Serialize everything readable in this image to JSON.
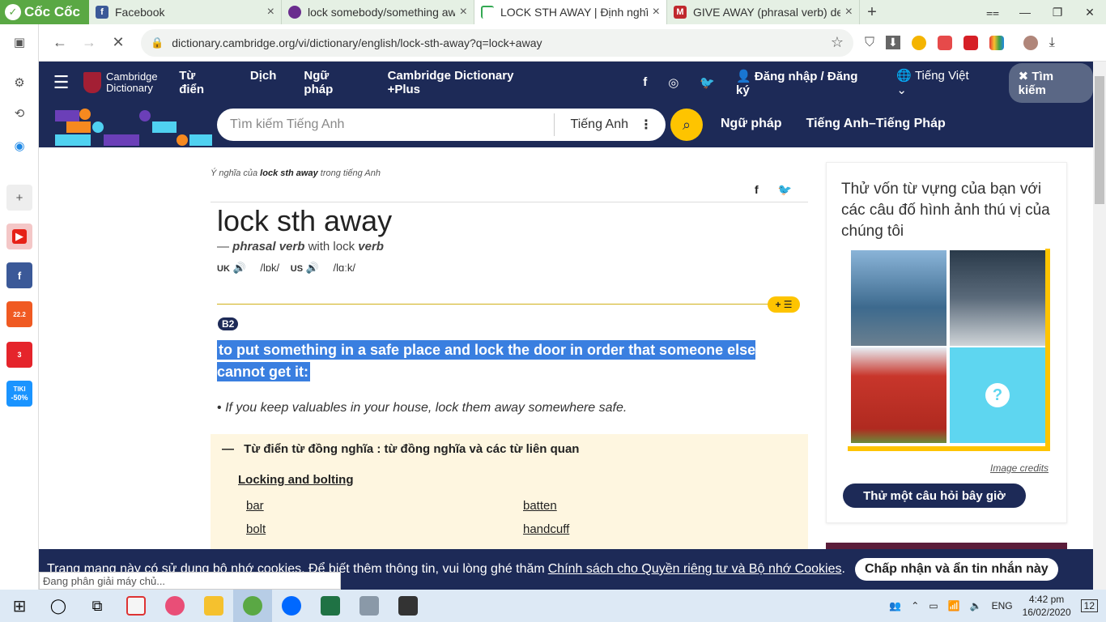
{
  "browser": {
    "brand": "Cốc Cốc",
    "tabs": [
      {
        "label": "Facebook",
        "active": false
      },
      {
        "label": "lock somebody/something aw",
        "active": false
      },
      {
        "label": "LOCK STH AWAY | Định nghĩa",
        "active": true
      },
      {
        "label": "GIVE AWAY (phrasal verb) def",
        "active": false
      }
    ],
    "url": "dictionary.cambridge.org/vi/dictionary/english/lock-sth-away?q=lock+away"
  },
  "header": {
    "logo_line1": "Cambridge",
    "logo_line2": "Dictionary",
    "nav": [
      "Từ điển",
      "Dịch",
      "Ngữ pháp",
      "Cambridge Dictionary +Plus"
    ],
    "login": "Đăng nhập / Đăng ký",
    "language": "Tiếng Việt",
    "search_button": "Tìm kiếm"
  },
  "search": {
    "placeholder": "Tìm kiếm Tiếng Anh",
    "dictionary": "Tiếng Anh",
    "links": [
      "Ngữ pháp",
      "Tiếng Anh–Tiếng Pháp"
    ]
  },
  "entry": {
    "breadcrumb_pre": "Ý nghĩa của",
    "breadcrumb_word": "lock sth away",
    "breadcrumb_post": "trong tiếng Anh",
    "headword": "lock sth away",
    "pos_dash": "—",
    "pos": "phrasal verb",
    "pos_with": "with lock",
    "pos_verb": "verb",
    "uk": "UK",
    "uk_ipa": "/lɒk/",
    "us": "US",
    "us_ipa": "/lɑːk/",
    "level": "B2",
    "definition": "to put something in a safe place and lock the door in order that someone else cannot get it:",
    "example": "If you keep valuables in your house, lock them away somewhere safe.",
    "thesaurus_header": "Từ điển từ đồng nghĩa : từ đồng nghĩa và các từ liên quan",
    "thesaurus_category": "Locking and bolting",
    "words": [
      "bar",
      "batten",
      "bolt",
      "handcuff"
    ]
  },
  "panel": {
    "title": "Thử vốn từ vựng của bạn với các câu đố hình ảnh thú vị của chúng tôi",
    "credits": "Image credits",
    "cta": "Thử một câu hỏi bây giờ"
  },
  "cookie": {
    "text": "Trang mạng này có sử dụng bộ nhớ cookies. Để biết thêm thông tin, vui lòng ghé thăm",
    "link": "Chính sách cho Quyền riêng tư và Bộ nhớ Cookies",
    "accept": "Chấp nhận và ẩn tin nhắn này"
  },
  "status": "Đang phân giải máy chủ...",
  "taskbar": {
    "lang": "ENG",
    "time": "4:42 pm",
    "date": "16/02/2020",
    "notifications": "12"
  },
  "sidebar": {
    "badge_shopee": "22.2",
    "badge_count": "3",
    "tiki": "TIKI",
    "tiki_sale": "-50%"
  }
}
